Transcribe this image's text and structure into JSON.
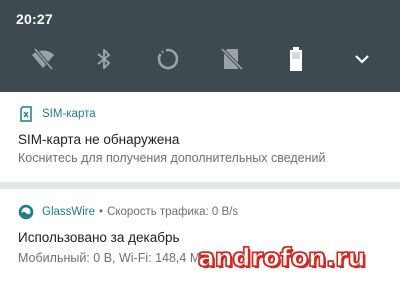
{
  "status_bar": {
    "time": "20:27"
  },
  "quick_settings": {
    "tiles": [
      "wifi-off-icon",
      "bluetooth-icon",
      "sync-icon",
      "no-sim-icon",
      "battery-icon"
    ],
    "expand_icon": "chevron-down-icon",
    "colors": {
      "background": "#3d4a50",
      "icon": "#9aa3a7",
      "battery": "#ffffff"
    }
  },
  "notifications": [
    {
      "app_name": "SIM-карта",
      "icon": "sim-card-icon",
      "title": "SIM-карта не обнаружена",
      "text": "Коснитесь для получения дополнительных сведений"
    },
    {
      "app_name": "GlassWire",
      "separator": "•",
      "subtext": "Скорость трафика: 0 B/s",
      "icon": "glasswire-icon",
      "title": "Использовано за декабрь",
      "text": "Мобильный: 0 B, Wi-Fi: 148,4 MB"
    }
  ],
  "watermark": {
    "text": "androfon.ru",
    "color": "#d8261e"
  },
  "colors": {
    "accent": "#1e7f84",
    "separator": "#e3e6e8"
  }
}
